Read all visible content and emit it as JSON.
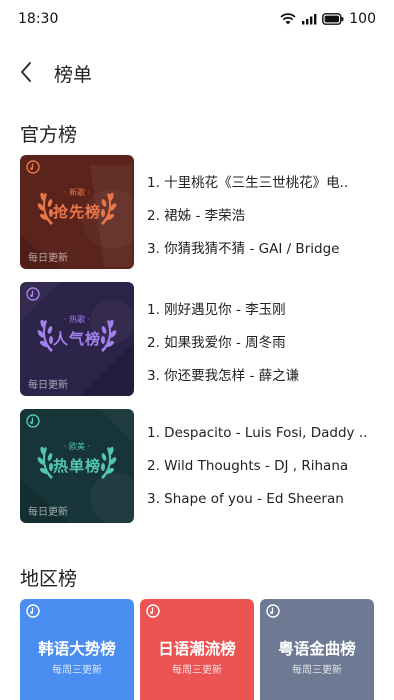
{
  "status": {
    "time": "18:30",
    "battery": "100",
    "wifi_icon": "wifi-icon",
    "signal_icon": "signal-icon",
    "battery_icon": "battery-icon"
  },
  "header": {
    "title": "榜单",
    "back_icon": "back-arrow-icon"
  },
  "official": {
    "title": "官方榜",
    "charts": [
      {
        "sub": "· 新歌 ·",
        "name": "抢先榜",
        "foot": "每日更新",
        "colors": {
          "bg": "#5a231c",
          "accent": "#e8784a"
        },
        "tracks": [
          "1. 十里桃花《三生三世桃花》电..",
          "2. 裙姊 - 李荣浩",
          "3. 你猜我猜不猜 - GAI / Bridge"
        ]
      },
      {
        "sub": "· 热歌 ·",
        "name": "人气榜",
        "foot": "每日更新",
        "colors": {
          "bg": "#2c2348",
          "accent": "#a480ee"
        },
        "tracks": [
          "1. 刚好遇见你 - 李玉刚",
          "2. 如果我爱你 - 周冬雨",
          "3. 你还要我怎样 - 薛之谦"
        ]
      },
      {
        "sub": "· 欧美 ·",
        "name": "热单榜",
        "foot": "每日更新",
        "colors": {
          "bg": "#173539",
          "accent": "#52c7ad"
        },
        "tracks": [
          "1. Despacito - Luis Fosi, Daddy ..",
          "2. Wild Thoughts - DJ , Rihana",
          "3. Shape of you - Ed Sheeran"
        ]
      }
    ]
  },
  "region": {
    "title": "地区榜",
    "charts": [
      {
        "name": "韩语大势榜",
        "sub": "每周三更新",
        "color": "#4a8df0"
      },
      {
        "name": "日语潮流榜",
        "sub": "每周三更新",
        "color": "#ec5454"
      },
      {
        "name": "粤语金曲榜",
        "sub": "每周三更新",
        "color": "#6e7a93"
      }
    ]
  }
}
